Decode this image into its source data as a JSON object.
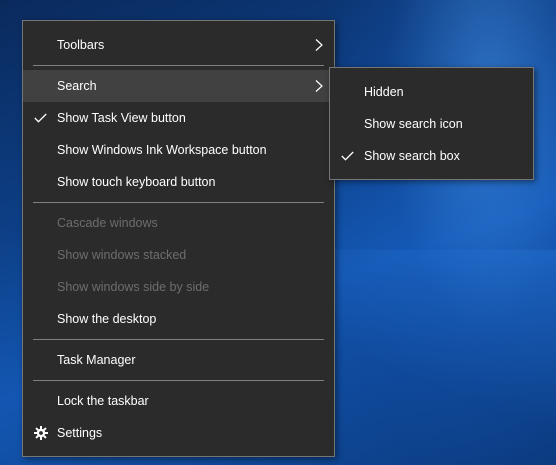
{
  "main_menu": {
    "items": [
      {
        "label": "Toolbars"
      },
      {
        "label": "Search"
      },
      {
        "label": "Show Task View button"
      },
      {
        "label": "Show Windows Ink Workspace button"
      },
      {
        "label": "Show touch keyboard button"
      },
      {
        "label": "Cascade windows"
      },
      {
        "label": "Show windows stacked"
      },
      {
        "label": "Show windows side by side"
      },
      {
        "label": "Show the desktop"
      },
      {
        "label": "Task Manager"
      },
      {
        "label": "Lock the taskbar"
      },
      {
        "label": "Settings"
      }
    ]
  },
  "search_submenu": {
    "items": [
      {
        "label": "Hidden"
      },
      {
        "label": "Show search icon"
      },
      {
        "label": "Show search box"
      }
    ]
  },
  "colors": {
    "menu_background": "#2b2b2b",
    "menu_border": "#767676",
    "highlight": "#414141",
    "text": "#ffffff",
    "disabled_text": "#6d6d6d",
    "desktop_accent": "#1357b3"
  },
  "icons": {
    "checked_indicator": "checkmark-icon",
    "submenu_indicator": "chevron-right-icon",
    "settings_indicator": "gear-icon"
  }
}
